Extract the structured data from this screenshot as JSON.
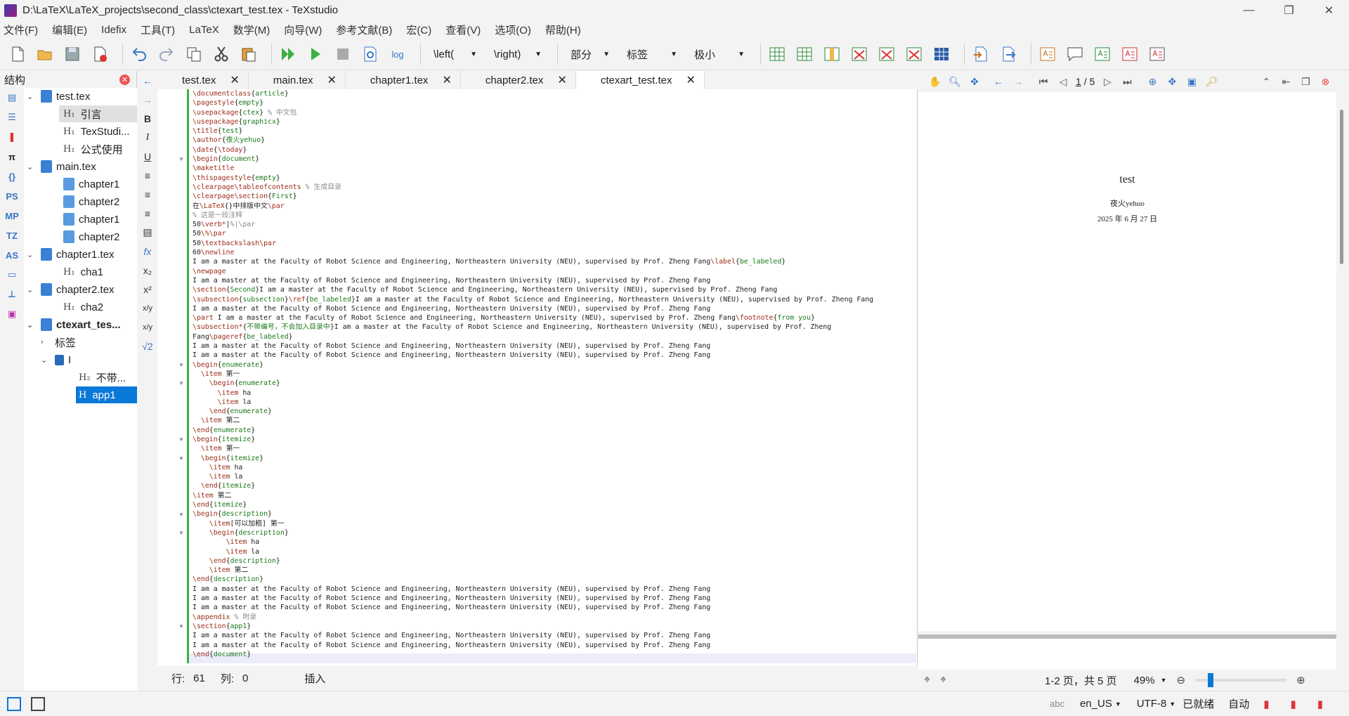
{
  "window": {
    "title": "D:\\LaTeX\\LaTeX_projects\\second_class\\ctexart_test.tex - TeXstudio",
    "minimize": "—",
    "restore": "❐",
    "close": "✕"
  },
  "menu": [
    "文件(F)",
    "编辑(E)",
    "Idefix",
    "工具(T)",
    "LaTeX",
    "数学(M)",
    "向导(W)",
    "参考文献(B)",
    "宏(C)",
    "查看(V)",
    "选项(O)",
    "帮助(H)"
  ],
  "toolbar": {
    "log_label": "log",
    "left_combo": "\\left(",
    "right_combo": "\\right)",
    "section_combo": "部分",
    "label_combo": "标签",
    "size_combo": "极小"
  },
  "structure": {
    "title": "结构",
    "nodes": [
      {
        "label": "test.tex",
        "type": "file"
      },
      {
        "label": "引言",
        "type": "h1"
      },
      {
        "label": "TexStudi...",
        "type": "h1"
      },
      {
        "label": "公式使用",
        "type": "h1"
      },
      {
        "label": "main.tex",
        "type": "file"
      },
      {
        "label": "chapter1",
        "type": "file"
      },
      {
        "label": "chapter2",
        "type": "file"
      },
      {
        "label": "chapter1",
        "type": "file"
      },
      {
        "label": "chapter2",
        "type": "file"
      },
      {
        "label": "chapter1.tex",
        "type": "file"
      },
      {
        "label": "cha1",
        "type": "h1"
      },
      {
        "label": "chapter2.tex",
        "type": "file"
      },
      {
        "label": "cha2",
        "type": "h1"
      },
      {
        "label": "ctexart_tes...",
        "type": "file"
      },
      {
        "label": "标签",
        "type": "folder"
      },
      {
        "label": "I",
        "type": "part"
      },
      {
        "label": "不带...",
        "type": "h2"
      },
      {
        "label": "app1",
        "type": "h1"
      }
    ],
    "side_icons": [
      "PS",
      "MP",
      "TZ",
      "AS"
    ]
  },
  "tabs": [
    {
      "label": "test.tex",
      "active": false
    },
    {
      "label": "main.tex",
      "active": false
    },
    {
      "label": "chapter1.tex",
      "active": false
    },
    {
      "label": "chapter2.tex",
      "active": false
    },
    {
      "label": "ctexart_test.tex",
      "active": true
    }
  ],
  "editor": {
    "lines": [
      "\\documentclass{article}",
      "\\pagestyle{empty}",
      "\\usepackage{ctex} % 中文包",
      "\\usepackage{graphicx}",
      "\\title{test}",
      "\\author{夜火yehuo}",
      "\\date{\\today}",
      "\\begin{document}",
      "\\maketitle",
      "\\thispagestyle{empty}",
      "\\clearpage\\tableofcontents % 生成目录",
      "\\clearpage\\section{First}",
      "在\\LaTeX{}中排版中文\\par",
      "% 这是一段注释",
      "50\\verb*|%|\\par",
      "50\\%\\par",
      "50\\textbackslash\\par",
      "60\\newline",
      "I am a master at the Faculty of Robot Science and Engineering, Northeastern University (NEU), supervised by Prof. Zheng Fang\\label{be_labeled}",
      "\\newpage",
      "I am a master at the Faculty of Robot Science and Engineering, Northeastern University (NEU), supervised by Prof. Zheng Fang",
      "\\section{Second}I am a master at the Faculty of Robot Science and Engineering, Northeastern University (NEU), supervised by Prof. Zheng Fang",
      "\\subsection{subsection}\\ref{be_labeled}I am a master at the Faculty of Robot Science and Engineering, Northeastern University (NEU), supervised by Prof. Zheng Fang",
      "I am a master at the Faculty of Robot Science and Engineering, Northeastern University (NEU), supervised by Prof. Zheng Fang",
      "\\part I am a master at the Faculty of Robot Science and Engineering, Northeastern University (NEU), supervised by Prof. Zheng Fang\\footnote{from you}",
      "\\subsection*{不带编号，不会加入目录中}I am a master at the Faculty of Robot Science and Engineering, Northeastern University (NEU), supervised by Prof. Zheng",
      "Fang\\pageref{be_labeled}",
      "I am a master at the Faculty of Robot Science and Engineering, Northeastern University (NEU), supervised by Prof. Zheng Fang",
      "I am a master at the Faculty of Robot Science and Engineering, Northeastern University (NEU), supervised by Prof. Zheng Fang",
      "\\begin{enumerate}",
      "  \\item 第一",
      "    \\begin{enumerate}",
      "      \\item ha",
      "      \\item la",
      "    \\end{enumerate}",
      "  \\item 第二",
      "\\end{enumerate}",
      "\\begin{itemize}",
      "  \\item 第一",
      "  \\begin{itemize}",
      "    \\item ha",
      "    \\item la",
      "  \\end{itemize}",
      "\\item 第二",
      "\\end{itemize}",
      "\\begin{description}",
      "    \\item[可以加粗] 第一",
      "    \\begin{description}",
      "        \\item ha",
      "        \\item la",
      "    \\end{description}",
      "    \\item 第二",
      "\\end{description}",
      "I am a master at the Faculty of Robot Science and Engineering, Northeastern University (NEU), supervised by Prof. Zheng Fang",
      "I am a master at the Faculty of Robot Science and Engineering, Northeastern University (NEU), supervised by Prof. Zheng Fang",
      "I am a master at the Faculty of Robot Science and Engineering, Northeastern University (NEU), supervised by Prof. Zheng Fang",
      "\\appendix % 附录",
      "\\section{app1}",
      "I am a master at the Faculty of Robot Science and Engineering, Northeastern University (NEU), supervised by Prof. Zheng Fang",
      "I am a master at the Faculty of Robot Science and Engineering, Northeastern University (NEU), supervised by Prof. Zheng Fang",
      "\\end{document}",
      ""
    ]
  },
  "status": {
    "row_label": "行:",
    "row_value": "61",
    "col_label": "列:",
    "col_value": "0",
    "mode": "插入"
  },
  "pdf": {
    "page_current": "1",
    "page_total": "/ 5",
    "doc_title": "test",
    "doc_author": "夜火yehuo",
    "doc_date": "2025 年 6 月 27 日",
    "pages_label": "1-2 页，共 5 页",
    "zoom": "49%"
  },
  "bottom": {
    "language": "en_US",
    "encoding": "UTF-8",
    "ready": "已就绪",
    "auto": "自动"
  },
  "colors": {
    "accent": "#0a78d7",
    "change_bar": "#3cb043",
    "keyword": "#9c2b17",
    "argument": "#1a7a1a"
  }
}
